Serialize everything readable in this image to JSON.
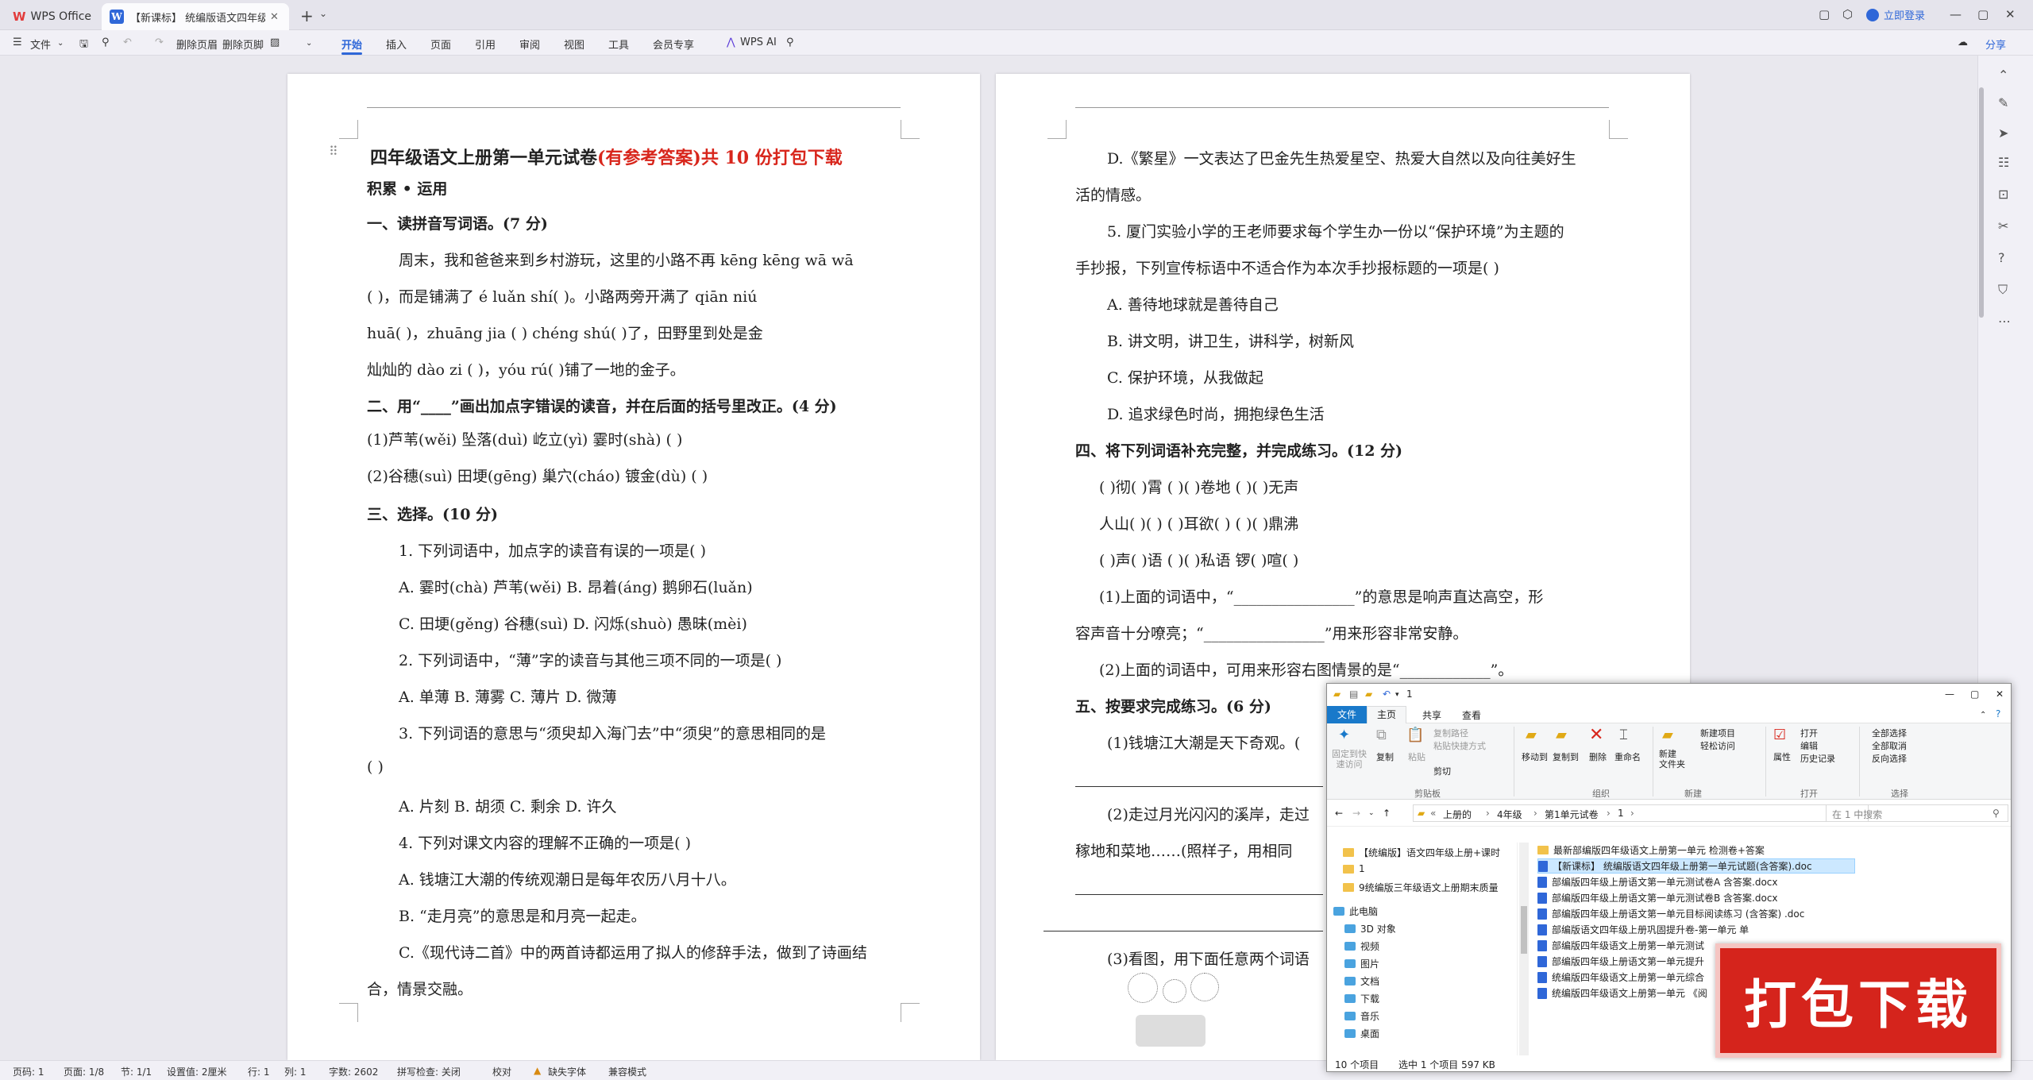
{
  "titlebar": {
    "home_tab": "WPS Office",
    "doc_tab": "【新课标】 统编版语文四年级",
    "login": "立即登录"
  },
  "toolbar": {
    "file_menu": "文件",
    "delete_header": "删除页眉",
    "delete_footer": "删除页脚",
    "tabs": [
      "开始",
      "插入",
      "页面",
      "引用",
      "审阅",
      "视图",
      "工具",
      "会员专享"
    ],
    "wps_ai": "WPS AI",
    "share": "分享"
  },
  "page1": {
    "title_black": "四年级语文上册第一单元试卷",
    "title_red": "(有参考答案)",
    "title_tail": "共 10 份打包下载",
    "section_head": "积累 • 运用",
    "q1_head": "一、读拼音写词语。(7 分)",
    "q1_line1": "周末，我和爸爸来到乡村游玩，这里的小路不再 kēng kēng wā  wā",
    "q1_line2": "(                    )，而是铺满了 é luǎn shí(               )。小路两旁开满了 qiān niú",
    "q1_line3": "huā(               )，zhuāng jia (             ) chéng shú(           )了，田野里到处是金",
    "q1_line4": "灿灿的 dào zi (              )，yóu rú(              )铺了一地的金子。",
    "q2_head": "二、用“____”画出加点字错误的读音，并在后面的括号里改正。(4 分)",
    "q2_line1": "(1)芦苇(wěi)        坠落(duì)         屹立(yì)          霎时(shà)         (       )",
    "q2_line2": "(2)谷穗(suì)        田埂(gēng)        巢穴(cháo)        镀金(dù)          (       )",
    "q3_head": "三、选择。(10 分)",
    "q3_1": "1. 下列词语中，加点字的读音有误的一项是(       )",
    "q3_1a": "A. 霎时(chà)        芦苇(wěi)        B. 昂着(áng)        鹅卵石(luǎn)",
    "q3_1c": "C. 田埂(gěng)       谷穗(suì)        D. 闪烁(shuò)       愚昧(mèi)",
    "q3_2": "2. 下列词语中，“薄”字的读音与其他三项不同的一项是(       )",
    "q3_2a": "A. 单薄              B. 薄雾               C. 薄片            D. 微薄",
    "q3_3": "3. 下列词语的意思与“须臾却入海门去”中“须臾”的意思相同的是",
    "q3_3b": "(       )",
    "q3_3a": "A. 片刻              B. 胡须               C. 剩余            D. 许久",
    "q3_4": "4. 下列对课文内容的理解不正确的一项是(       )",
    "q3_4a": "A. 钱塘江大潮的传统观潮日是每年农历八月十八。",
    "q3_4b": "B. “走月亮”的意思是和月亮一起走。",
    "q3_4c": "C.《现代诗二首》中的两首诗都运用了拟人的修辞手法，做到了诗画结",
    "q3_4c2": "合，情景交融。"
  },
  "page2": {
    "d_line1": "D.《繁星》一文表达了巴金先生热爱星空、热爱大自然以及向往美好生",
    "d_line2": "活的情感。",
    "q5_line1": "5. 厦门实验小学的王老师要求每个学生办一份以“保护环境”为主题的",
    "q5_line2": "手抄报，下列宣传标语中不适合作为本次手抄报标题的一项是(       )",
    "q5_a": "A. 善待地球就是善待自己",
    "q5_b": "B. 讲文明，讲卫生，讲科学，树新风",
    "q5_c": "C. 保护环境，从我做起",
    "q5_d": "D. 追求绿色时尚，拥抱绿色生活",
    "q4_head": "四、将下列词语补充完整，并完成练习。(12 分)",
    "q4_row1": "(       )彻(       )霄          (       )(       )卷地          (       )(       )无声",
    "q4_row2": "人山(       )(       )          (       )耳欲(       )          (       )(       )鼎沸",
    "q4_row3": "(       )声(       )语          (       )(       )私语          锣(      )喧(      )",
    "q4_p1": "(1)上面的词语中，“________________”的意思是响声直达高空，形",
    "q4_p1b": "容声音十分嘹亮；“________________”用来形容非常安静。",
    "q4_p2": "(2)上面的词语中，可用来形容右图情景的是“____________”。",
    "q5_head": "五、按要求完成练习。(6 分)",
    "q5s_1": "(1)钱塘江大潮是天下奇观。(",
    "q5s_2": "(2)走过月光闪闪的溪岸，走过",
    "q5s_2b": "稼地和菜地……(照样子，用相同",
    "q5s_3": "(3)看图，用下面任意两个词语"
  },
  "statusbar": {
    "page_no": "页码: 1",
    "page": "页面: 1/8",
    "section": "节: 1/1",
    "setting": "设置值: 2厘米",
    "row": "行: 1",
    "col": "列: 1",
    "words": "字数: 2602",
    "spell": "拼写检查: 关闭",
    "proof": "校对",
    "missing_font": "缺失字体",
    "compat": "兼容模式"
  },
  "explorer": {
    "title": "1",
    "tabs": [
      "文件",
      "主页",
      "共享",
      "查看"
    ],
    "ribbon": {
      "pin": "固定到快\n速访问",
      "copy": "复制",
      "paste": "粘贴",
      "copy_path": "复制路径",
      "paste_shortcut": "粘贴快捷方式",
      "cut": "剪切",
      "move_to": "移动到",
      "copy_to": "复制到",
      "delete": "删除",
      "rename": "重命名",
      "new_folder": "新建\n文件夹",
      "new_item": "新建项目",
      "easy_access": "轻松访问",
      "properties": "属性",
      "open": "打开",
      "edit": "编辑",
      "history": "历史记录",
      "select_all": "全部选择",
      "select_none": "全部取消",
      "invert": "反向选择",
      "groups": [
        "剪贴板",
        "组织",
        "新建",
        "打开",
        "选择"
      ]
    },
    "path": [
      "上册的",
      "4年级",
      "第1单元试卷",
      "1"
    ],
    "search_placeholder": "在 1 中搜索",
    "nav": [
      "【统编版】语文四年级上册+课时",
      "1",
      "9统编版三年级语文上册期末质量",
      "此电脑",
      "3D 对象",
      "视频",
      "图片",
      "文档",
      "下载",
      "音乐",
      "桌面"
    ],
    "files": [
      "最新部编版四年级语文上册第一单元  检测卷+答案",
      "【新课标】 统编版语文四年级上册第一单元试题(含答案).doc",
      "部编版四年级上册语文第一单元测试卷A     含答案.docx",
      "部编版四年级上册语文第一单元测试卷B     含答案.docx",
      "部编版四年级上册语文第一单元目标阅读练习  (含答案) .doc",
      "部编版语文四年级上册巩固提升卷-第一单元 单",
      "部编版四年级语文上册第一单元测试",
      "部编版四年级上册语文第一单元提升",
      "统编版四年级语文上册第一单元综合",
      "统编版四年级语文上册第一单元 《阅"
    ],
    "status_count": "10 个项目",
    "status_sel": "选中 1 个项目  597 KB"
  },
  "promo": {
    "text": "打包下载"
  }
}
